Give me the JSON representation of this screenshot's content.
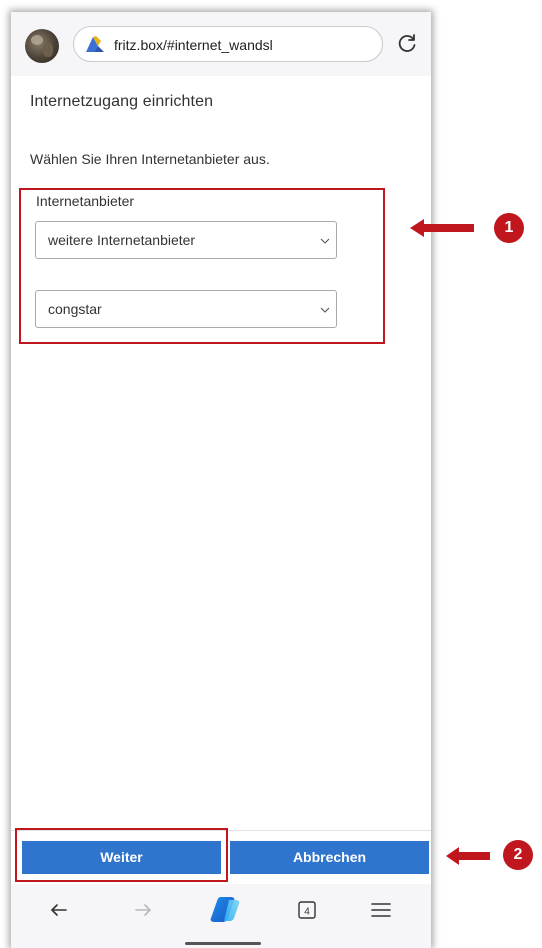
{
  "browser": {
    "url": "fritz.box/#internet_wandsl",
    "tab_count": "4"
  },
  "page": {
    "title": "Internetzugang einrichten",
    "intro": "Wählen Sie Ihren Internetanbieter aus.",
    "provider_group": {
      "legend": "Internetanbieter",
      "category_select": "weitere Internetanbieter",
      "provider_select": "congstar"
    }
  },
  "footer": {
    "next_label": "Weiter",
    "cancel_label": "Abbrechen"
  },
  "annotations": {
    "badge_1": "1",
    "badge_2": "2"
  },
  "colors": {
    "annotation_red": "#c0161e",
    "button_blue": "#2f74cd"
  }
}
